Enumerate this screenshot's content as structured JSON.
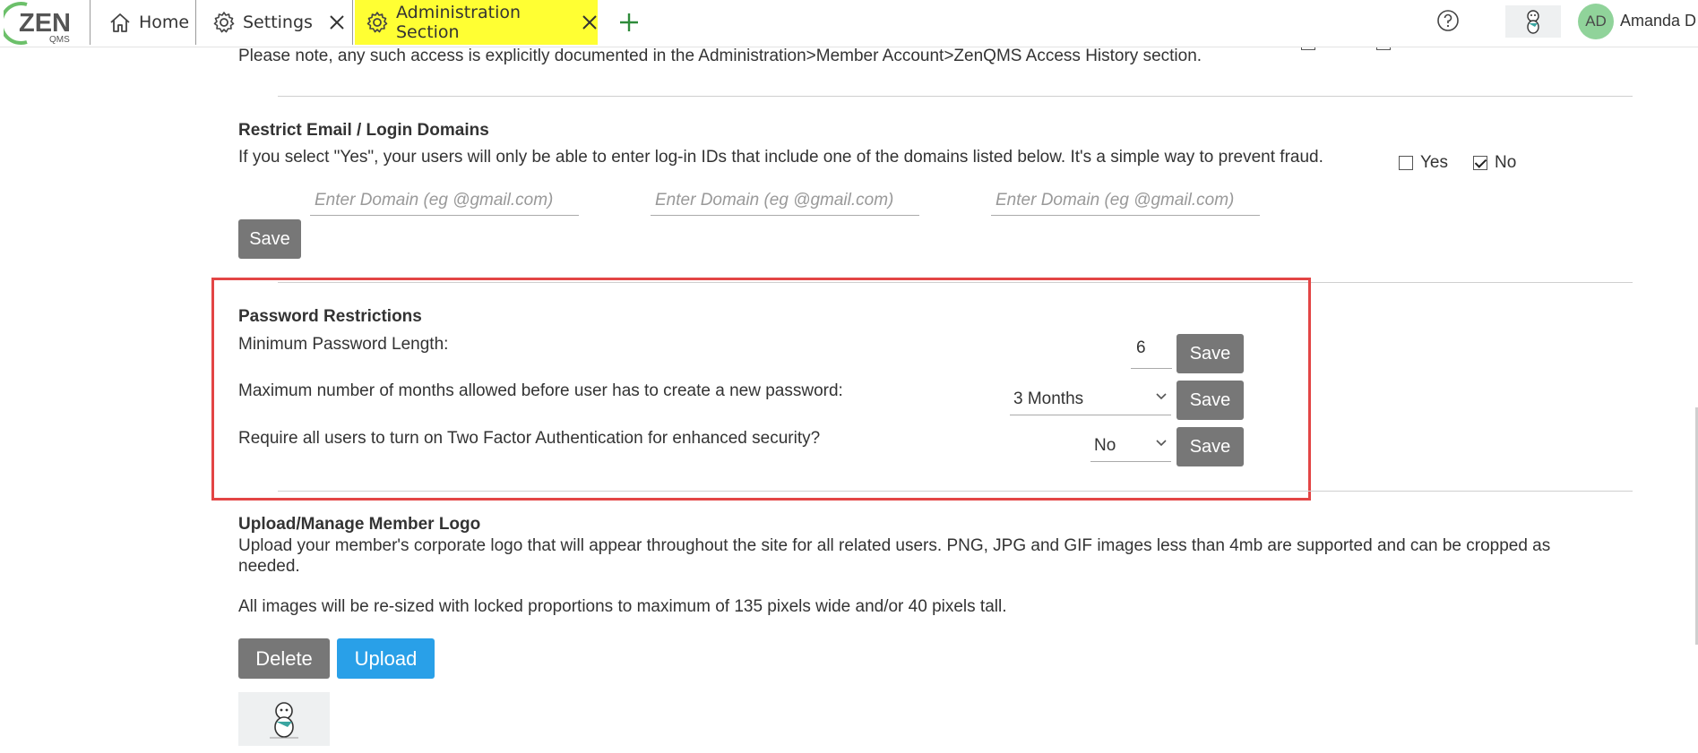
{
  "app": {
    "logo_main": "ZEN",
    "logo_sub": "QMS",
    "logo_ring_color": "#6cc06a"
  },
  "tabs": [
    {
      "label": "Home",
      "icon": "home-icon"
    },
    {
      "label": "Settings",
      "icon": "gear-icon"
    },
    {
      "label": "Administration Section",
      "icon": "gear-icon",
      "active": true,
      "highlight_color": "#ffff33"
    }
  ],
  "topbar": {
    "help_icon": "help-icon",
    "user_initials": "AD",
    "user_name": "Amanda D",
    "avatar_color": "#90d39a"
  },
  "access_note": "Please note, any such access is explicitly documented in the Administration>Member Account>ZenQMS Access History section.",
  "restrict_email": {
    "title": "Restrict Email / Login Domains",
    "description": "If you select \"Yes\", your users will only be able to enter log-in IDs that include one of the domains listed below. It's a simple way to prevent fraud.",
    "yes_label": "Yes",
    "no_label": "No",
    "yes_checked": false,
    "no_checked": true,
    "domain_placeholder": "Enter Domain (eg @gmail.com)",
    "save_label": "Save"
  },
  "password": {
    "title": "Password Restrictions",
    "min_length_label": "Minimum Password Length:",
    "min_length_value": "6",
    "max_months_label": "Maximum number of months allowed before user has to create a new password:",
    "max_months_value": "3 Months",
    "two_factor_label": "Require all users to turn on Two Factor Authentication for enhanced security?",
    "two_factor_value": "No",
    "save_label": "Save",
    "highlight_color": "#e34545"
  },
  "logo_section": {
    "title": "Upload/Manage Member Logo",
    "description_1": "Upload your member's corporate logo that will appear throughout the site for all related users. PNG, JPG and GIF images less than 4mb are supported and can be cropped as",
    "description_2": "needed.",
    "resize_note": "All images will be re-sized with locked proportions to maximum of 135 pixels wide and/or 40 pixels tall.",
    "delete_label": "Delete",
    "upload_label": "Upload",
    "upload_color": "#29a0e8"
  }
}
